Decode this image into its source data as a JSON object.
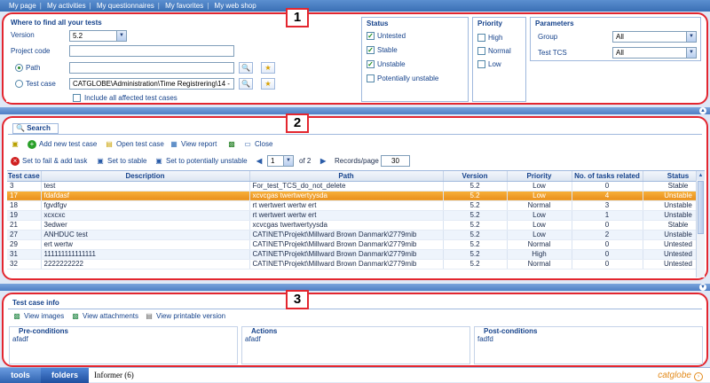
{
  "topnav": [
    "My page",
    "My activities",
    "My questionnaires",
    "My favorites",
    "My web shop"
  ],
  "panel_numbers": [
    "1",
    "2",
    "3"
  ],
  "where": {
    "title": "Where to find all your tests",
    "version_label": "Version",
    "version_value": "5.2",
    "project_code_label": "Project code",
    "project_code_value": "",
    "path_label": "Path",
    "path_value": "",
    "test_case_label": "Test case",
    "test_case_value": "CATGLOBE\\Administration\\Time Registrering\\14 -",
    "include_label": "Include all affected test cases"
  },
  "status": {
    "title": "Status",
    "items": [
      {
        "label": "Untested",
        "checked": true
      },
      {
        "label": "Stable",
        "checked": true
      },
      {
        "label": "Unstable",
        "checked": true
      },
      {
        "label": "Potentially unstable",
        "checked": false
      }
    ]
  },
  "priority": {
    "title": "Priority",
    "items": [
      {
        "label": "High",
        "checked": false
      },
      {
        "label": "Normal",
        "checked": false
      },
      {
        "label": "Low",
        "checked": false
      }
    ]
  },
  "parameters": {
    "title": "Parameters",
    "group_label": "Group",
    "group_value": "All",
    "tcs_label": "Test TCS",
    "tcs_value": "All"
  },
  "search_tab": "Search",
  "toolbar1": {
    "add": "Add new test case",
    "open": "Open test case",
    "report": "View report",
    "close": "Close"
  },
  "toolbar2": {
    "fail": "Set to fail & add task",
    "stable": "Set to stable",
    "pot": "Set to potentially unstable",
    "page": "1",
    "of": "of 2",
    "records_label": "Records/page",
    "records_value": "30"
  },
  "table": {
    "columns": [
      "Test case",
      "Description",
      "Path",
      "Version",
      "Priority",
      "No. of tasks related",
      "Status"
    ],
    "rows": [
      [
        "3",
        "test",
        "For_test_TCS_do_not_delete",
        "5.2",
        "Low",
        "0",
        "Stable"
      ],
      [
        "17",
        "fdafdasf",
        "xcvcgas twertwertyysda",
        "5.2",
        "Low",
        "4",
        "Unstable"
      ],
      [
        "18",
        "fgvdfgv",
        "rt wertwert wertw ert",
        "5.2",
        "Normal",
        "3",
        "Unstable"
      ],
      [
        "19",
        "xcxcxc",
        "rt wertwert wertw ert",
        "5.2",
        "Low",
        "1",
        "Unstable"
      ],
      [
        "21",
        "3edwer",
        "xcvcgas twertwertyysda",
        "5.2",
        "Low",
        "0",
        "Stable"
      ],
      [
        "27",
        "ANHDUC test",
        "CATINET\\Projekt\\Millward Brown Danmark\\2779mib",
        "5.2",
        "Low",
        "2",
        "Unstable"
      ],
      [
        "29",
        "ert wertw",
        "CATINET\\Projekt\\Millward Brown Danmark\\2779mib",
        "5.2",
        "Normal",
        "0",
        "Untested"
      ],
      [
        "31",
        "111111111111111",
        "CATINET\\Projekt\\Millward Brown Danmark\\2779mib",
        "5.2",
        "High",
        "0",
        "Untested"
      ],
      [
        "32",
        "2222222222",
        "CATINET\\Projekt\\Millward Brown Danmark\\2779mib",
        "5.2",
        "Normal",
        "0",
        "Untested"
      ]
    ]
  },
  "info": {
    "title": "Test case info",
    "view_images": "View images",
    "view_attachments": "View attachments",
    "view_printable": "View printable version",
    "pre_label": "Pre-conditions",
    "pre_value": "afadf",
    "actions_label": "Actions",
    "actions_value": "afadf",
    "post_label": "Post-conditions",
    "post_value": "fadfd"
  },
  "statusbar": {
    "tools": "tools",
    "folders": "folders",
    "informer": "Informer (6)",
    "logo": "catglobe"
  },
  "colors": {
    "accent": "#e3262f",
    "header": "#3a6fb5",
    "selected_row": "#f0a030"
  }
}
